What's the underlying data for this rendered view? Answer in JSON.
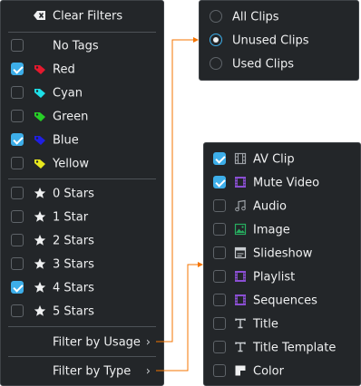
{
  "main_menu": {
    "clear_filters": "Clear Filters",
    "no_tags": "No Tags",
    "tags": [
      {
        "label": "Red",
        "color": "#e5192e",
        "checked": true
      },
      {
        "label": "Cyan",
        "color": "#1ee0e8",
        "checked": false
      },
      {
        "label": "Green",
        "color": "#27cf27",
        "checked": false
      },
      {
        "label": "Blue",
        "color": "#1f1fe3",
        "checked": true
      },
      {
        "label": "Yellow",
        "color": "#e8e81e",
        "checked": false
      }
    ],
    "ratings": [
      {
        "label": "0 Stars",
        "checked": false
      },
      {
        "label": "1 Star",
        "checked": false
      },
      {
        "label": "2 Stars",
        "checked": false
      },
      {
        "label": "3 Stars",
        "checked": false
      },
      {
        "label": "4 Stars",
        "checked": true
      },
      {
        "label": "5 Stars",
        "checked": false
      }
    ],
    "filter_by_usage": "Filter by Usage",
    "filter_by_type": "Filter by Type",
    "chevron": "›"
  },
  "usage_menu": {
    "items": [
      {
        "label": "All Clips",
        "checked": false
      },
      {
        "label": "Unused Clips",
        "checked": true
      },
      {
        "label": "Used Clips",
        "checked": false
      }
    ]
  },
  "type_menu": {
    "items": [
      {
        "label": "AV Clip",
        "icon": "film-icon",
        "checked": true
      },
      {
        "label": "Mute Video",
        "icon": "video-icon",
        "checked": true
      },
      {
        "label": "Audio",
        "icon": "music-note-icon",
        "checked": false
      },
      {
        "label": "Image",
        "icon": "image-icon",
        "checked": false
      },
      {
        "label": "Slideshow",
        "icon": "slideshow-icon",
        "checked": false
      },
      {
        "label": "Playlist",
        "icon": "playlist-icon",
        "checked": false
      },
      {
        "label": "Sequences",
        "icon": "sequence-icon",
        "checked": false
      },
      {
        "label": "Title",
        "icon": "title-icon",
        "checked": false
      },
      {
        "label": "Title Template",
        "icon": "title-template-icon",
        "checked": false
      },
      {
        "label": "Color",
        "icon": "color-clip-icon",
        "checked": false
      }
    ]
  },
  "colors": {
    "accent": "#3daee9",
    "connector": "#f67400",
    "menu_bg": "#232629"
  }
}
